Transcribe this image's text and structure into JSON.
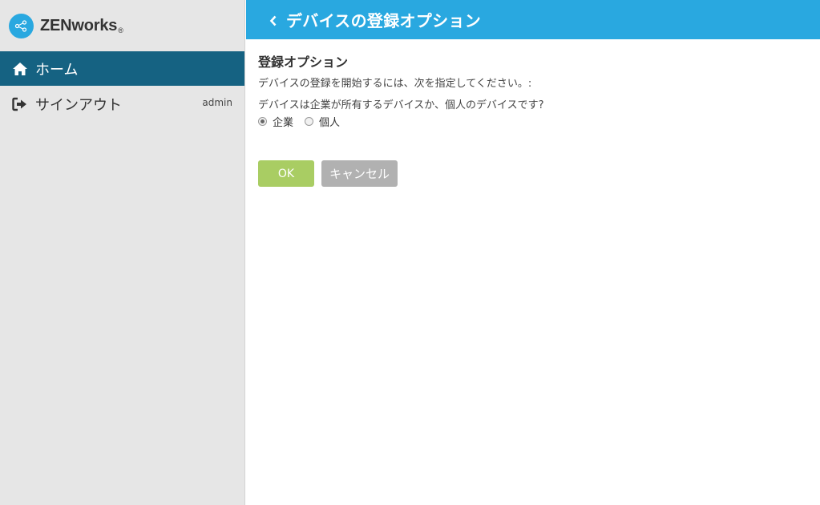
{
  "brand": {
    "name": "ZENworks",
    "reg_mark": "®",
    "logo_icon": "share-nodes-icon"
  },
  "sidebar": {
    "items": [
      {
        "label": "ホーム",
        "icon": "home-icon",
        "active": true
      },
      {
        "label": "サインアウト",
        "icon": "sign-out-icon",
        "active": false,
        "user": "admin"
      }
    ]
  },
  "header": {
    "back_icon": "chevron-left-icon",
    "title": "デバイスの登録オプション"
  },
  "content": {
    "section_title": "登録オプション",
    "instruction": "デバイスの登録を開始するには、次を指定してください。:",
    "question": "デバイスは企業が所有するデバイスか、個人のデバイスです?",
    "options": [
      {
        "label": "企業",
        "checked": true
      },
      {
        "label": "個人",
        "checked": false
      }
    ]
  },
  "actions": {
    "ok_label": "OK",
    "cancel_label": "キャンセル"
  },
  "colors": {
    "header_bg": "#29a8e0",
    "nav_active_bg": "#156282",
    "sidebar_bg": "#e6e6e6",
    "ok_bg": "#a9cd63",
    "cancel_bg": "#b1b1b1"
  }
}
